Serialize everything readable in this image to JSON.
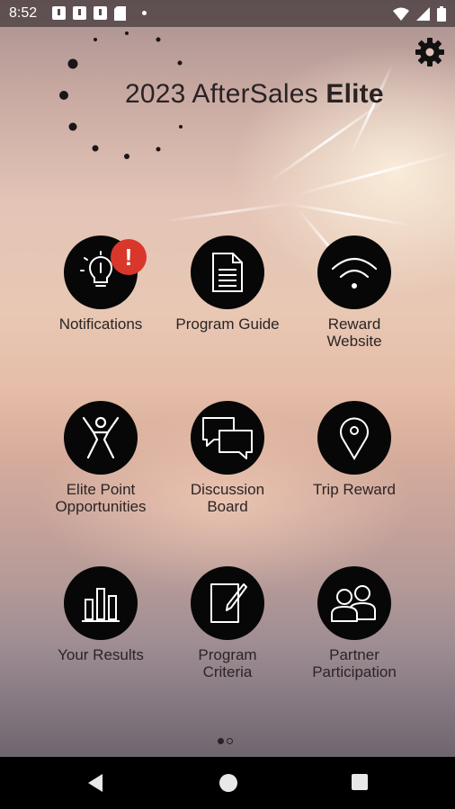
{
  "status_bar": {
    "time": "8:52",
    "icons": [
      "message-icon",
      "message-icon",
      "message-icon",
      "sd-card-icon",
      "dot-icon"
    ],
    "right_icons": [
      "wifi-icon",
      "signal-icon",
      "battery-icon"
    ]
  },
  "header": {
    "title_regular": "2023 AfterSales ",
    "title_bold": "Elite",
    "settings_icon": "gear-icon"
  },
  "tiles": [
    {
      "label": "Notifications",
      "icon": "lightbulb-icon",
      "badge": "!"
    },
    {
      "label": "Program Guide",
      "icon": "document-icon"
    },
    {
      "label": "Reward Website",
      "icon": "wifi-icon"
    },
    {
      "label": "Elite Point Opportunities",
      "icon": "person-cheering-icon"
    },
    {
      "label": "Discussion Board",
      "icon": "chat-bubbles-icon"
    },
    {
      "label": "Trip Reward",
      "icon": "map-pin-icon"
    },
    {
      "label": "Your Results",
      "icon": "bar-chart-icon"
    },
    {
      "label": "Program Criteria",
      "icon": "clipboard-pen-icon"
    },
    {
      "label": "Partner Participation",
      "icon": "people-icon"
    }
  ],
  "tile_labels": {
    "t0": "Notifications",
    "t1": "Program Guide",
    "t2a": "Reward",
    "t2b": "Website",
    "t3a": "Elite Point",
    "t3b": "Opportunities",
    "t4a": "Discussion",
    "t4b": "Board",
    "t5": "Trip Reward",
    "t6": "Your Results",
    "t7a": "Program",
    "t7b": "Criteria",
    "t8a": "Partner",
    "t8b": "Participation"
  },
  "pager": {
    "current_page": 1,
    "total_pages": 2
  },
  "navigation": [
    "back-icon",
    "home-icon",
    "recents-icon"
  ],
  "colors": {
    "badge": "#d9372b",
    "tile_circle": "#070707"
  }
}
